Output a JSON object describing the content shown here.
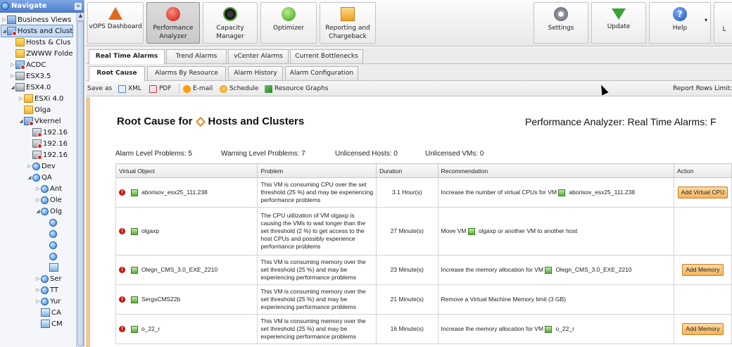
{
  "nav": {
    "title": "Navigate",
    "tree": [
      {
        "label": "Business Views",
        "icon": "business-views-icon",
        "depth": 0,
        "expand": "▷"
      },
      {
        "label": "Hosts and Clust",
        "icon": "hosts-clusters-icon",
        "depth": 0,
        "expand": "◢",
        "selected": true
      },
      {
        "label": "Hosts & Clus",
        "icon": "folder-icon",
        "depth": 1,
        "expand": ""
      },
      {
        "label": "ZWWW Folde",
        "icon": "folder-icon",
        "depth": 1,
        "expand": ""
      },
      {
        "label": "ACDC",
        "icon": "datacenter-icon",
        "depth": 1,
        "expand": "▷"
      },
      {
        "label": "ESX3.5",
        "icon": "host-icon",
        "depth": 1,
        "expand": "▷"
      },
      {
        "label": "ESX4.0",
        "icon": "host-icon",
        "depth": 1,
        "expand": "◢"
      },
      {
        "label": "ESXi 4.0",
        "icon": "folder-icon",
        "depth": 2,
        "expand": "▷"
      },
      {
        "label": "Olga",
        "icon": "folder-icon",
        "depth": 2,
        "expand": ""
      },
      {
        "label": "Vkernel",
        "icon": "datacenter-icon",
        "depth": 2,
        "expand": "◢"
      },
      {
        "label": "192.16",
        "icon": "host-icon",
        "depth": 3,
        "expand": ""
      },
      {
        "label": "192.16",
        "icon": "host-icon",
        "depth": 3,
        "expand": ""
      },
      {
        "label": "192.16",
        "icon": "host-icon",
        "depth": 3,
        "expand": ""
      },
      {
        "label": "Dev",
        "icon": "resource-pool-icon",
        "depth": 3,
        "expand": "▷"
      },
      {
        "label": "QA",
        "icon": "resource-pool-icon",
        "depth": 3,
        "expand": "◢"
      },
      {
        "label": "Ant",
        "icon": "resource-pool-icon",
        "depth": 4,
        "expand": "▷"
      },
      {
        "label": "Ole",
        "icon": "resource-pool-icon",
        "depth": 4,
        "expand": "▷"
      },
      {
        "label": "Olg",
        "icon": "resource-pool-icon",
        "depth": 4,
        "expand": "◢"
      },
      {
        "label": "",
        "icon": "resource-pool-icon",
        "depth": 5,
        "expand": ""
      },
      {
        "label": "",
        "icon": "resource-pool-icon",
        "depth": 5,
        "expand": ""
      },
      {
        "label": "",
        "icon": "resource-pool-icon",
        "depth": 5,
        "expand": ""
      },
      {
        "label": "",
        "icon": "resource-pool-icon",
        "depth": 5,
        "expand": ""
      },
      {
        "label": "",
        "icon": "vm-icon",
        "depth": 5,
        "expand": ""
      },
      {
        "label": "Ser",
        "icon": "resource-pool-icon",
        "depth": 4,
        "expand": "▷"
      },
      {
        "label": "TT",
        "icon": "resource-pool-icon",
        "depth": 4,
        "expand": "▷"
      },
      {
        "label": "Yur",
        "icon": "resource-pool-icon",
        "depth": 4,
        "expand": "▷"
      },
      {
        "label": "CA",
        "icon": "vm-icon",
        "depth": 4,
        "expand": ""
      },
      {
        "label": "CM",
        "icon": "vm-icon",
        "depth": 4,
        "expand": ""
      }
    ]
  },
  "toolbar": {
    "vops": "vOPS Dashboard",
    "perf_1": "Performance",
    "perf_2": "Analyzer",
    "cap_1": "Capacity",
    "cap_2": "Manager",
    "opt": "Optimizer",
    "rep_1": "Reporting and",
    "rep_2": "Chargeback",
    "settings": "Settings",
    "update": "Update",
    "help": "Help",
    "help_glyph": "?",
    "dropdown_arrow": "▾",
    "l_partial": "L"
  },
  "tabs1": [
    "Real Time Alarms",
    "Trend Alarms",
    "vCenter Alarms",
    "Current Bottlenecks"
  ],
  "tabs2": [
    "Root Cause",
    "Alarms By Resource",
    "Alarm History",
    "Alarm Configuration"
  ],
  "savebar": {
    "save_as": "Save as",
    "xml": "XML",
    "pdf": "PDF",
    "email": "E-mail",
    "schedule": "Schedule",
    "graphs": "Resource Graphs",
    "rows_limit": "Report Rows Limit:"
  },
  "content": {
    "title_prefix": "Root Cause for",
    "title_object": "Hosts and Clusters",
    "right_title": "Performance Analyzer: Real Time Alarms: F",
    "summary": {
      "alarm": "Alarm Level Problems: 5",
      "warning": "Warning Level Problems: 7",
      "hosts": "Unlicensed Hosts: 0",
      "vms": "Unlicensed VMs: 0"
    },
    "columns": [
      "Virtual Object",
      "Problem",
      "Duration",
      "Recommendation",
      "Action"
    ],
    "rows": [
      {
        "object": "aborisov_esx25_111.238",
        "problem": "This VM is consuming CPU over the set threshold (25 %) and may be experiencing performance problems",
        "duration": "3.1 Hour(s)",
        "rec_prefix": "Increase the number of virtual CPUs for VM",
        "rec_vm": "aborisov_esx25_111.238",
        "rec_suffix": "",
        "action": "Add Virtual CPU"
      },
      {
        "object": "olgaxp",
        "problem": "The CPU utilization of VM olgaxp is causing the VMs to wait longer than the set threshold (2 %) to get access to the host CPUs and possibly experience performance problems",
        "duration": "27 Minute(s)",
        "rec_prefix": "Move VM",
        "rec_vm": "olgaxp",
        "rec_suffix": "or another VM to another host",
        "action": ""
      },
      {
        "object": "Olegn_CMS_3.0_EXE_2210",
        "problem": "This VM is consuming memory over the set threshold (25 %) and may be experiencing performance problems",
        "duration": "23 Minute(s)",
        "rec_prefix": "Increase the memory allocation for VM",
        "rec_vm": "Olegn_CMS_3.0_EXE_2210",
        "rec_suffix": "",
        "action": "Add Memory"
      },
      {
        "object": "SergsCMS22b",
        "problem": "This VM is consuming memory over the set threshold (25 %) and may be experiencing performance problems",
        "duration": "21 Minute(s)",
        "rec_prefix": "Remove a Virtual Machine Memory limit (3 GB)",
        "rec_vm": "",
        "rec_suffix": "",
        "action": ""
      },
      {
        "object": "o_22_r",
        "problem": "This VM is consuming memory over the set threshold (25 %) and may be experiencing performance problems",
        "duration": "16 Minute(s)",
        "rec_prefix": "Increase the memory allocation for VM",
        "rec_vm": "o_22_r",
        "rec_suffix": "",
        "action": "Add Memory"
      }
    ]
  }
}
